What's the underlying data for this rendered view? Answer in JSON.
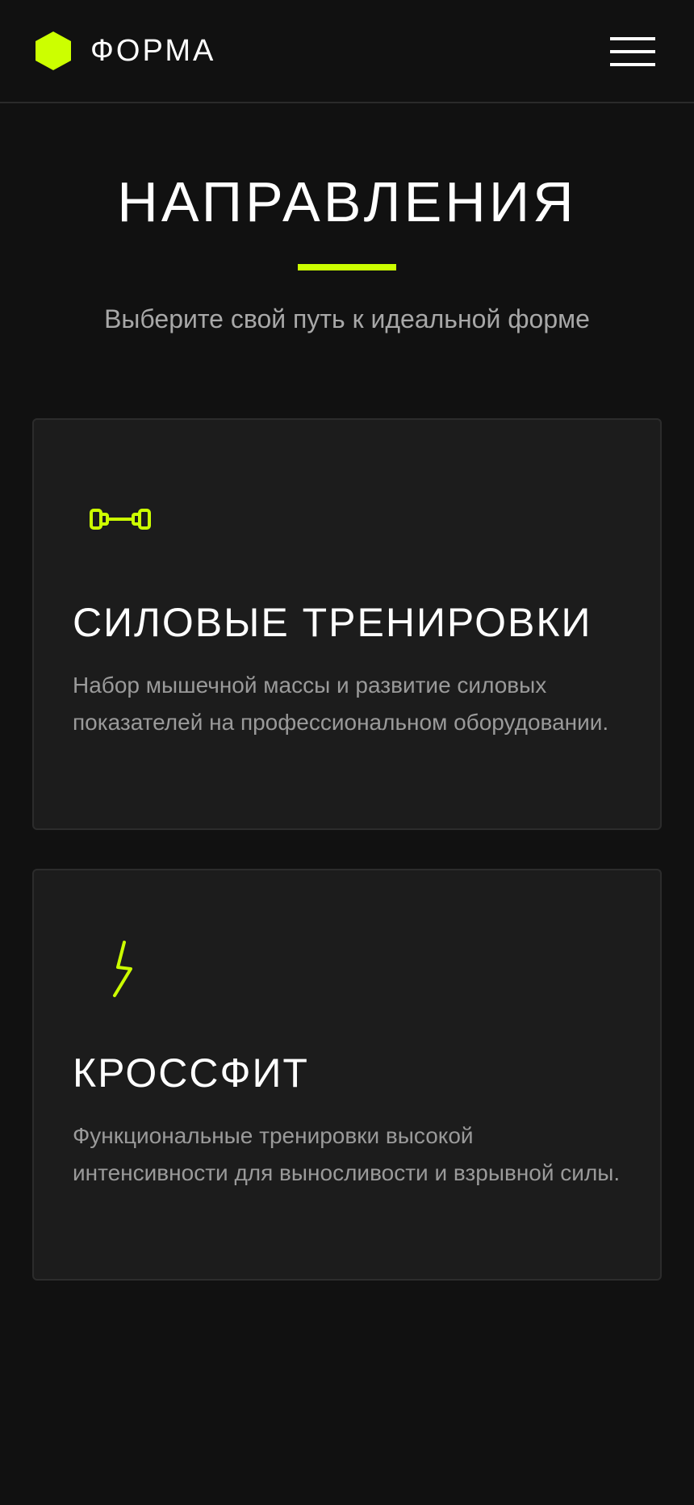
{
  "header": {
    "logo_text": "ФОРМА",
    "logo_icon": "hexagon-logo-icon",
    "menu_icon": "hamburger-menu-icon"
  },
  "section": {
    "title": "НАПРАВЛЕНИЯ",
    "subtitle": "Выберите свой путь к идеальной форме"
  },
  "cards": [
    {
      "icon": "dumbbell-icon",
      "title": "СИЛОВЫЕ ТРЕНИРОВКИ",
      "text": "Набор мышечной массы и развитие силовых показателей на профессиональном оборудовании."
    },
    {
      "icon": "lightning-icon",
      "title": "КРОССФИТ",
      "text": "Функциональные тренировки высокой интенсивности для выносливости и взрывной силы."
    }
  ],
  "colors": {
    "background": "#111111",
    "card_background": "#1c1c1c",
    "accent": "#ccff00",
    "text_primary": "#ffffff",
    "text_secondary": "#a8a8a8"
  }
}
